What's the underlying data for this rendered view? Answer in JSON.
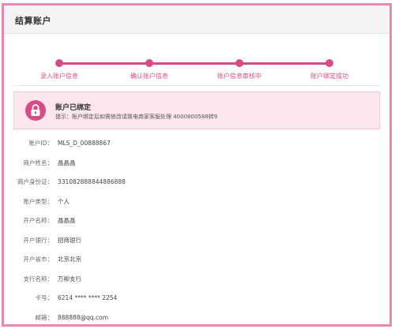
{
  "header": {
    "title": "结算账户"
  },
  "steps": [
    {
      "label": "录入账户信息"
    },
    {
      "label": "确认账户信息"
    },
    {
      "label": "账户信息审核中"
    },
    {
      "label": "账户绑定成功"
    }
  ],
  "status": {
    "title": "账户已绑定",
    "hint": "提示：账户绑定后如需修改请致电商家客服处理 4000800588转9"
  },
  "account": {
    "rows": [
      {
        "label": "账户ID：",
        "value": "MLS_D_00888867"
      },
      {
        "label": "商户姓名：",
        "value": "晶晶晶"
      },
      {
        "label": "商户身份证：",
        "value": "331082888844886888"
      },
      {
        "label": "账户类型：",
        "value": "个人"
      },
      {
        "label": "开户名称：",
        "value": "晶晶晶"
      },
      {
        "label": "开户银行：",
        "value": "招商银行"
      },
      {
        "label": "开户省市：",
        "value": "北京北京"
      },
      {
        "label": "支行名称：",
        "value": "万柳支行"
      },
      {
        "label": "卡号：",
        "value": "6214 **** **** 2254"
      },
      {
        "label": "邮箱：",
        "value": "888888@qq.com"
      }
    ]
  },
  "colors": {
    "accent": "#d94b86",
    "frame": "#e889b3",
    "status_bg": "#fde6ee"
  },
  "icons": {
    "status": "lock-icon"
  }
}
